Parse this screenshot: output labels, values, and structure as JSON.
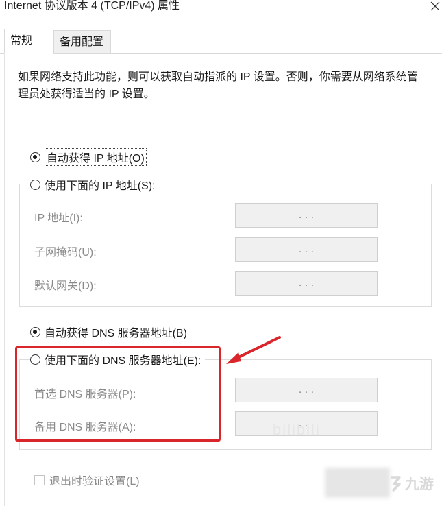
{
  "window": {
    "title": "Internet 协议版本 4 (TCP/IPv4) 属性"
  },
  "tabs": [
    {
      "label": "常规"
    },
    {
      "label": "备用配置"
    }
  ],
  "description": "如果网络支持此功能，则可以获取自动指派的 IP 设置。否则，你需要从网络系统管理员处获得适当的 IP 设置。",
  "ip_section": {
    "auto_label": "自动获得 IP 地址(O)",
    "auto_checked": true,
    "manual_label": "使用下面的 IP 地址(S):",
    "manual_checked": false,
    "fields": [
      {
        "label": "IP 地址(I):",
        "value": ". . ."
      },
      {
        "label": "子网掩码(U):",
        "value": ". . ."
      },
      {
        "label": "默认网关(D):",
        "value": ". . ."
      }
    ]
  },
  "dns_section": {
    "auto_label": "自动获得 DNS 服务器地址(B)",
    "auto_checked": true,
    "manual_label": "使用下面的 DNS 服务器地址(E):",
    "manual_checked": false,
    "fields": [
      {
        "label": "首选 DNS 服务器(P):",
        "value": ". . ."
      },
      {
        "label": "备用 DNS 服务器(A):",
        "value": ". . ."
      }
    ]
  },
  "validate_checkbox": {
    "label": "退出时验证设置(L)",
    "checked": false
  },
  "annotation": {
    "highlight_color": "#d9262b"
  },
  "watermarks": {
    "text": "bilibili",
    "logo_text": "九游"
  }
}
